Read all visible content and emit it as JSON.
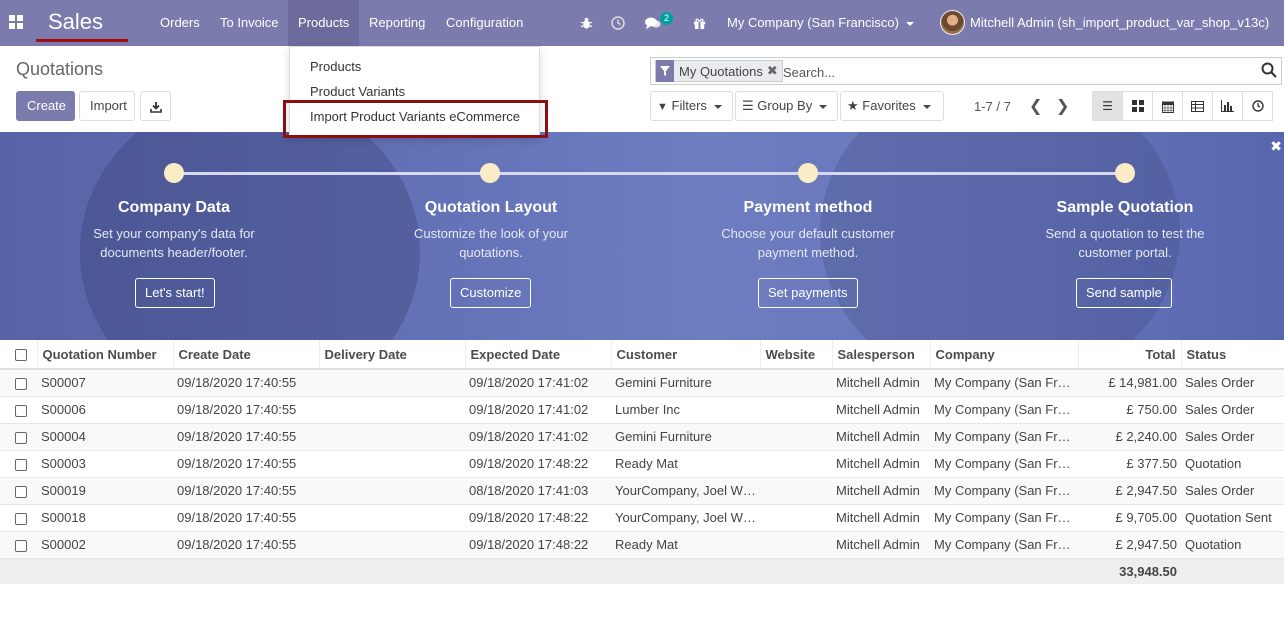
{
  "navbar": {
    "brand": "Sales",
    "menus": [
      "Orders",
      "To Invoice",
      "Products",
      "Reporting",
      "Configuration"
    ],
    "chat_badge": "2",
    "company": "My Company (San Francisco)",
    "user": "Mitchell Admin (sh_import_product_var_shop_v13c)"
  },
  "products_menu": {
    "items": [
      "Products",
      "Product Variants",
      "Import Product Variants eCommerce"
    ]
  },
  "control_panel": {
    "title": "Quotations",
    "create": "Create",
    "import": "Import",
    "facet": "My Quotations",
    "search_placeholder": "Search...",
    "filters": "Filters",
    "group_by": "Group By",
    "favorites": "Favorites",
    "pager": "1-7 / 7"
  },
  "banner": {
    "steps": [
      {
        "title": "Company Data",
        "desc1": "Set your company's data for",
        "desc2": "documents header/footer.",
        "button": "Let's start!"
      },
      {
        "title": "Quotation Layout",
        "desc1": "Customize the look of your",
        "desc2": "quotations.",
        "button": "Customize"
      },
      {
        "title": "Payment method",
        "desc1": "Choose your default customer",
        "desc2": "payment method.",
        "button": "Set payments"
      },
      {
        "title": "Sample Quotation",
        "desc1": "Send a quotation to test the",
        "desc2": "customer portal.",
        "button": "Send sample"
      }
    ]
  },
  "table": {
    "headers": {
      "number": "Quotation Number",
      "create_date": "Create Date",
      "delivery_date": "Delivery Date",
      "expected_date": "Expected Date",
      "customer": "Customer",
      "website": "Website",
      "salesperson": "Salesperson",
      "company": "Company",
      "total": "Total",
      "status": "Status"
    },
    "rows": [
      {
        "number": "S00007",
        "create_date": "09/18/2020 17:40:55",
        "delivery_date": "",
        "expected_date": "09/18/2020 17:41:02",
        "customer": "Gemini Furniture",
        "website": "",
        "salesperson": "Mitchell Admin",
        "company": "My Company (San Fr…",
        "total": "£ 14,981.00",
        "status": "Sales Order"
      },
      {
        "number": "S00006",
        "create_date": "09/18/2020 17:40:55",
        "delivery_date": "",
        "expected_date": "09/18/2020 17:41:02",
        "customer": "Lumber Inc",
        "website": "",
        "salesperson": "Mitchell Admin",
        "company": "My Company (San Fr…",
        "total": "£ 750.00",
        "status": "Sales Order"
      },
      {
        "number": "S00004",
        "create_date": "09/18/2020 17:40:55",
        "delivery_date": "",
        "expected_date": "09/18/2020 17:41:02",
        "customer": "Gemini Furniture",
        "website": "",
        "salesperson": "Mitchell Admin",
        "company": "My Company (San Fr…",
        "total": "£ 2,240.00",
        "status": "Sales Order"
      },
      {
        "number": "S00003",
        "create_date": "09/18/2020 17:40:55",
        "delivery_date": "",
        "expected_date": "09/18/2020 17:48:22",
        "customer": "Ready Mat",
        "website": "",
        "salesperson": "Mitchell Admin",
        "company": "My Company (San Fr…",
        "total": "£ 377.50",
        "status": "Quotation"
      },
      {
        "number": "S00019",
        "create_date": "09/18/2020 17:40:55",
        "delivery_date": "",
        "expected_date": "08/18/2020 17:41:03",
        "customer": "YourCompany, Joel W…",
        "website": "",
        "salesperson": "Mitchell Admin",
        "company": "My Company (San Fr…",
        "total": "£ 2,947.50",
        "status": "Sales Order"
      },
      {
        "number": "S00018",
        "create_date": "09/18/2020 17:40:55",
        "delivery_date": "",
        "expected_date": "09/18/2020 17:48:22",
        "customer": "YourCompany, Joel W…",
        "website": "",
        "salesperson": "Mitchell Admin",
        "company": "My Company (San Fr…",
        "total": "£ 9,705.00",
        "status": "Quotation Sent"
      },
      {
        "number": "S00002",
        "create_date": "09/18/2020 17:40:55",
        "delivery_date": "",
        "expected_date": "09/18/2020 17:48:22",
        "customer": "Ready Mat",
        "website": "",
        "salesperson": "Mitchell Admin",
        "company": "My Company (San Fr…",
        "total": "£ 2,947.50",
        "status": "Quotation"
      }
    ],
    "footer_total": "33,948.50"
  },
  "colors": {
    "brand": "#7c7bad",
    "highlight_frame": "#8b0e12",
    "banner": "#6472b7"
  }
}
